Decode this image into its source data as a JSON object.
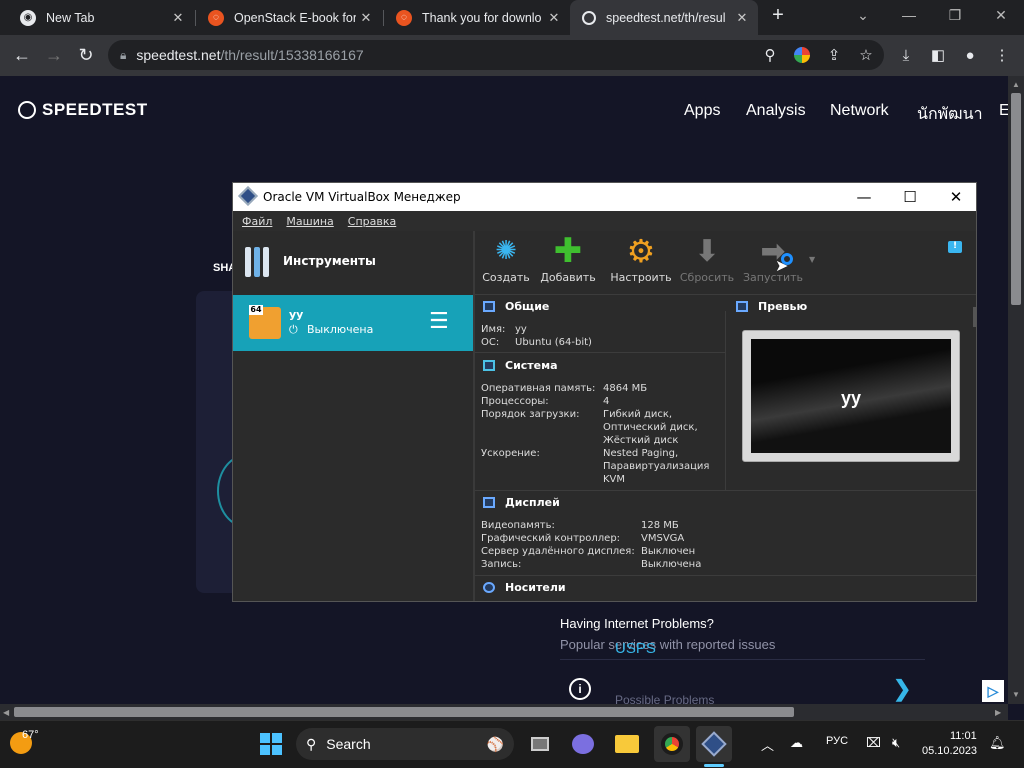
{
  "browser": {
    "tabs": [
      {
        "title": "New Tab",
        "icon": "chrome-icon"
      },
      {
        "title": "OpenStack E-book for",
        "icon": "ubuntu-icon"
      },
      {
        "title": "Thank you for downlo",
        "icon": "ubuntu-icon"
      },
      {
        "title": "speedtest.net/th/resul",
        "icon": "speedtest-icon"
      }
    ],
    "new_tab_glyph": "+",
    "url_domain": "speedtest.net",
    "url_path": "/th/result/15338166167"
  },
  "page": {
    "logo": "SPEEDTEST",
    "nav": [
      "Apps",
      "Analysis",
      "Network",
      "นักพัฒนา",
      "E"
    ],
    "share_label": "SHA",
    "help_title": "Having Internet Problems?",
    "help_subtitle": "Popular services with reported issues",
    "issue_name": "USPS",
    "issue_sub": "Possible Problems",
    "info_glyph": "i",
    "adchoice_glyph": "▷"
  },
  "vbox": {
    "title": "Oracle VM VirtualBox Менеджер",
    "menu": [
      "Файл",
      "Машина",
      "Справка"
    ],
    "tools_label": "Инструменты",
    "vm": {
      "name": "уу",
      "state": "Выключена",
      "badge": "64"
    },
    "toolbar": [
      {
        "label": "Создать",
        "icon": "new-icon",
        "enabled": true
      },
      {
        "label": "Добавить",
        "icon": "add-icon",
        "enabled": true
      },
      {
        "label": "Настроить",
        "icon": "settings-icon",
        "enabled": true
      },
      {
        "label": "Сбросить",
        "icon": "discard-icon",
        "enabled": false
      },
      {
        "label": "Запустить",
        "icon": "start-icon",
        "enabled": false
      }
    ],
    "general": {
      "header": "Общие",
      "rows": [
        {
          "k": "Имя:",
          "v": "уу"
        },
        {
          "k": "ОС:",
          "v": "Ubuntu (64-bit)"
        }
      ]
    },
    "preview": {
      "header": "Превью",
      "screen_text": "уу"
    },
    "system": {
      "header": "Система",
      "ram_k": "Оперативная память:",
      "ram_v": "4864 МБ",
      "cpu_k": "Процессоры:",
      "cpu_v": "4",
      "boot_k": "Порядок загрузки:",
      "boot_v": [
        "Гибкий диск,",
        "Оптический диск,",
        "Жёсткий диск"
      ],
      "accel_k": "Ускорение:",
      "accel_v": [
        "Nested Paging,",
        "Паравиртуализация",
        "KVM"
      ]
    },
    "display": {
      "header": "Дисплей",
      "rows": [
        {
          "k": "Видеопамять:",
          "v": "128 МБ"
        },
        {
          "k": "Графический контроллер:",
          "v": "VMSVGA"
        },
        {
          "k": "Сервер удалённого дисплея:",
          "v": "Выключен"
        },
        {
          "k": "Запись:",
          "v": "Выключена"
        }
      ]
    },
    "storage": {
      "header": "Носители"
    }
  },
  "taskbar": {
    "weather": "67°",
    "search": "Search",
    "lang": "РУС",
    "time": "11:01",
    "date": "05.10.2023"
  },
  "colors": {
    "page_bg": "#141526",
    "vm_selected": "#17a2b8",
    "link": "#36b6e8"
  }
}
